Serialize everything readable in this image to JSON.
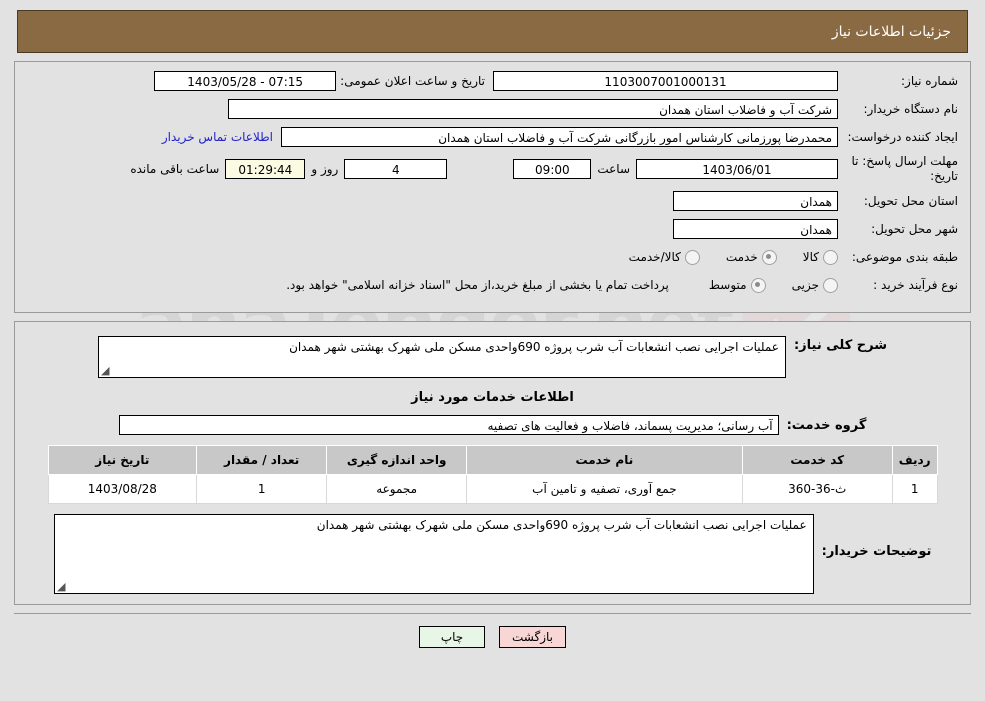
{
  "header": {
    "title": "جزئیات اطلاعات نیاز"
  },
  "watermark": {
    "text": "anaTender.net"
  },
  "form": {
    "need_number": {
      "label": "شماره نیاز:",
      "value": "1103007001000131"
    },
    "announce": {
      "label": "تاریخ و ساعت اعلان عمومی:",
      "value": "07:15 - 1403/05/28"
    },
    "buyer_org": {
      "label": "نام دستگاه خریدار:",
      "value": "شرکت آب و فاضلاب استان همدان"
    },
    "requester": {
      "label": "ایجاد کننده درخواست:",
      "value": "محمدرضا پورزمانی کارشناس امور بازرگانی شرکت آب و فاضلاب استان همدان",
      "contact_link": "اطلاعات تماس خریدار"
    },
    "deadline": {
      "label": "مهلت ارسال پاسخ: تا تاریخ:",
      "date": "1403/06/01",
      "time_label": "ساعت",
      "time": "09:00",
      "days": "4",
      "days_label": "روز و",
      "clock": "01:29:44",
      "remaining_label": "ساعت باقی مانده"
    },
    "delivery_province": {
      "label": "استان محل تحویل:",
      "value": "همدان"
    },
    "delivery_city": {
      "label": "شهر محل تحویل:",
      "value": "همدان"
    },
    "category": {
      "label": "طبقه بندی موضوعی:",
      "options": [
        {
          "label": "کالا",
          "selected": false
        },
        {
          "label": "خدمت",
          "selected": true
        },
        {
          "label": "کالا/خدمت",
          "selected": false
        }
      ]
    },
    "purchase_process": {
      "label": "نوع فرآیند خرید :",
      "options": [
        {
          "label": "جزیی",
          "selected": false
        },
        {
          "label": "متوسط",
          "selected": true
        }
      ],
      "note": "پرداخت تمام یا بخشی از مبلغ خرید،از محل \"اسناد خزانه اسلامی\" خواهد بود."
    }
  },
  "description": {
    "label": "شرح کلی نیاز:",
    "value": "عملیات اجرایی نصب انشعابات آب شرب پروژه 690واحدی مسکن ملی شهرک بهشتی شهر همدان"
  },
  "services_section": {
    "title": "اطلاعات خدمات مورد نیاز",
    "group": {
      "label": "گروه خدمت:",
      "value": "آب رسانی؛ مدیریت پسماند، فاضلاب و فعالیت های تصفیه"
    },
    "table": {
      "columns": [
        "ردیف",
        "کد خدمت",
        "نام خدمت",
        "واحد اندازه گیری",
        "تعداد / مقدار",
        "تاریخ نیاز"
      ],
      "rows": [
        {
          "radif": "1",
          "code": "ث-36-360",
          "name": "جمع آوری، تصفیه و تامین آب",
          "unit": "مجموعه",
          "qty": "1",
          "date": "1403/08/28"
        }
      ]
    }
  },
  "buyer_notes": {
    "label": "توضیحات خریدار:",
    "value": "عملیات اجرایی نصب انشعابات آب شرب پروژه 690واحدی مسکن ملی شهرک بهشتی شهر همدان"
  },
  "footer": {
    "print_label": "چاپ",
    "back_label": "بازگشت"
  },
  "colors": {
    "header_bg": "#8a6a42",
    "page_bg": "#e2e2e2",
    "link": "#2222cc",
    "print_btn": "#e7f6e7",
    "back_btn": "#f9d6d6",
    "countdown_bg": "#fbfbe3",
    "table_header_bg": "#c8c8c8"
  }
}
